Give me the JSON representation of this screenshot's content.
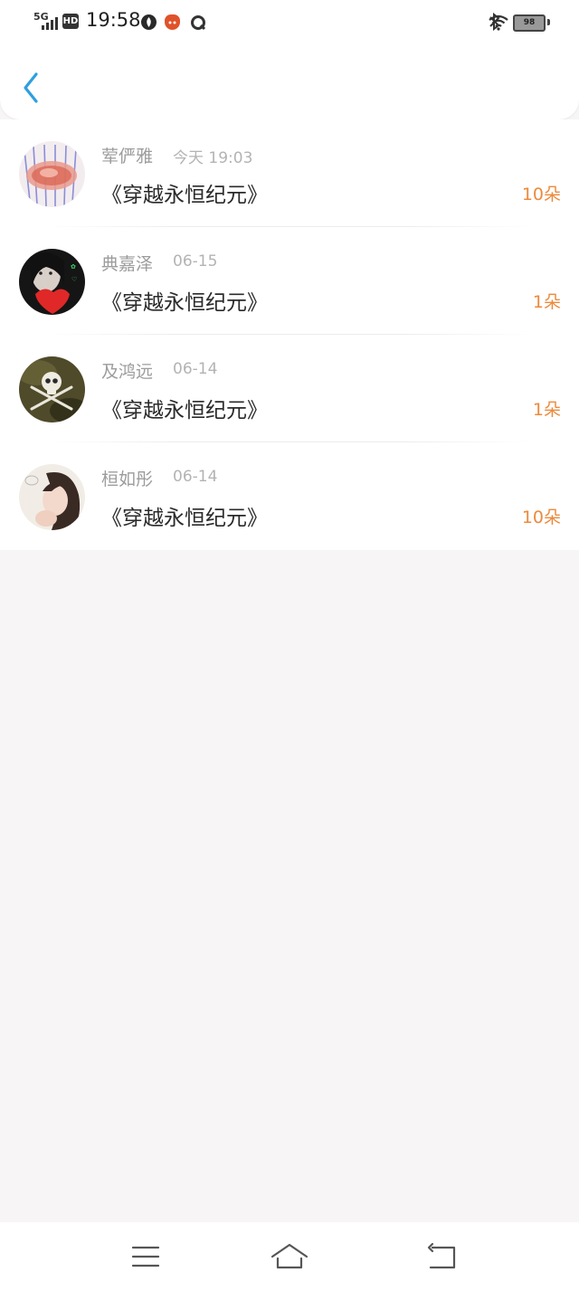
{
  "status_bar": {
    "network": "5G",
    "hd": "HD",
    "time": "19:58",
    "battery": "98",
    "icons": [
      "signal-icon",
      "hd-icon",
      "app-notification-icon",
      "app-notification-icon",
      "app-notification-icon",
      "bluetooth-icon",
      "wifi-icon",
      "battery-icon"
    ]
  },
  "header": {
    "back_icon": "chevron-left-icon"
  },
  "gifts": [
    {
      "name": "荤俨雅",
      "time": "今天 19:03",
      "book": "《穿越永恒纪元》",
      "count": "10朵"
    },
    {
      "name": "典嘉泽",
      "time": "06-15",
      "book": "《穿越永恒纪元》",
      "count": "1朵"
    },
    {
      "name": "及鸿远",
      "time": "06-14",
      "book": "《穿越永恒纪元》",
      "count": "1朵"
    },
    {
      "name": "桓如彤",
      "time": "06-14",
      "book": "《穿越永恒纪元》",
      "count": "10朵"
    }
  ],
  "nav_bar": {
    "icons": [
      "menu-icon",
      "home-icon",
      "back-icon"
    ]
  },
  "colors": {
    "accent": "#2f9fe0",
    "count": "#ec8a3c",
    "background": "#f7f5f6"
  }
}
